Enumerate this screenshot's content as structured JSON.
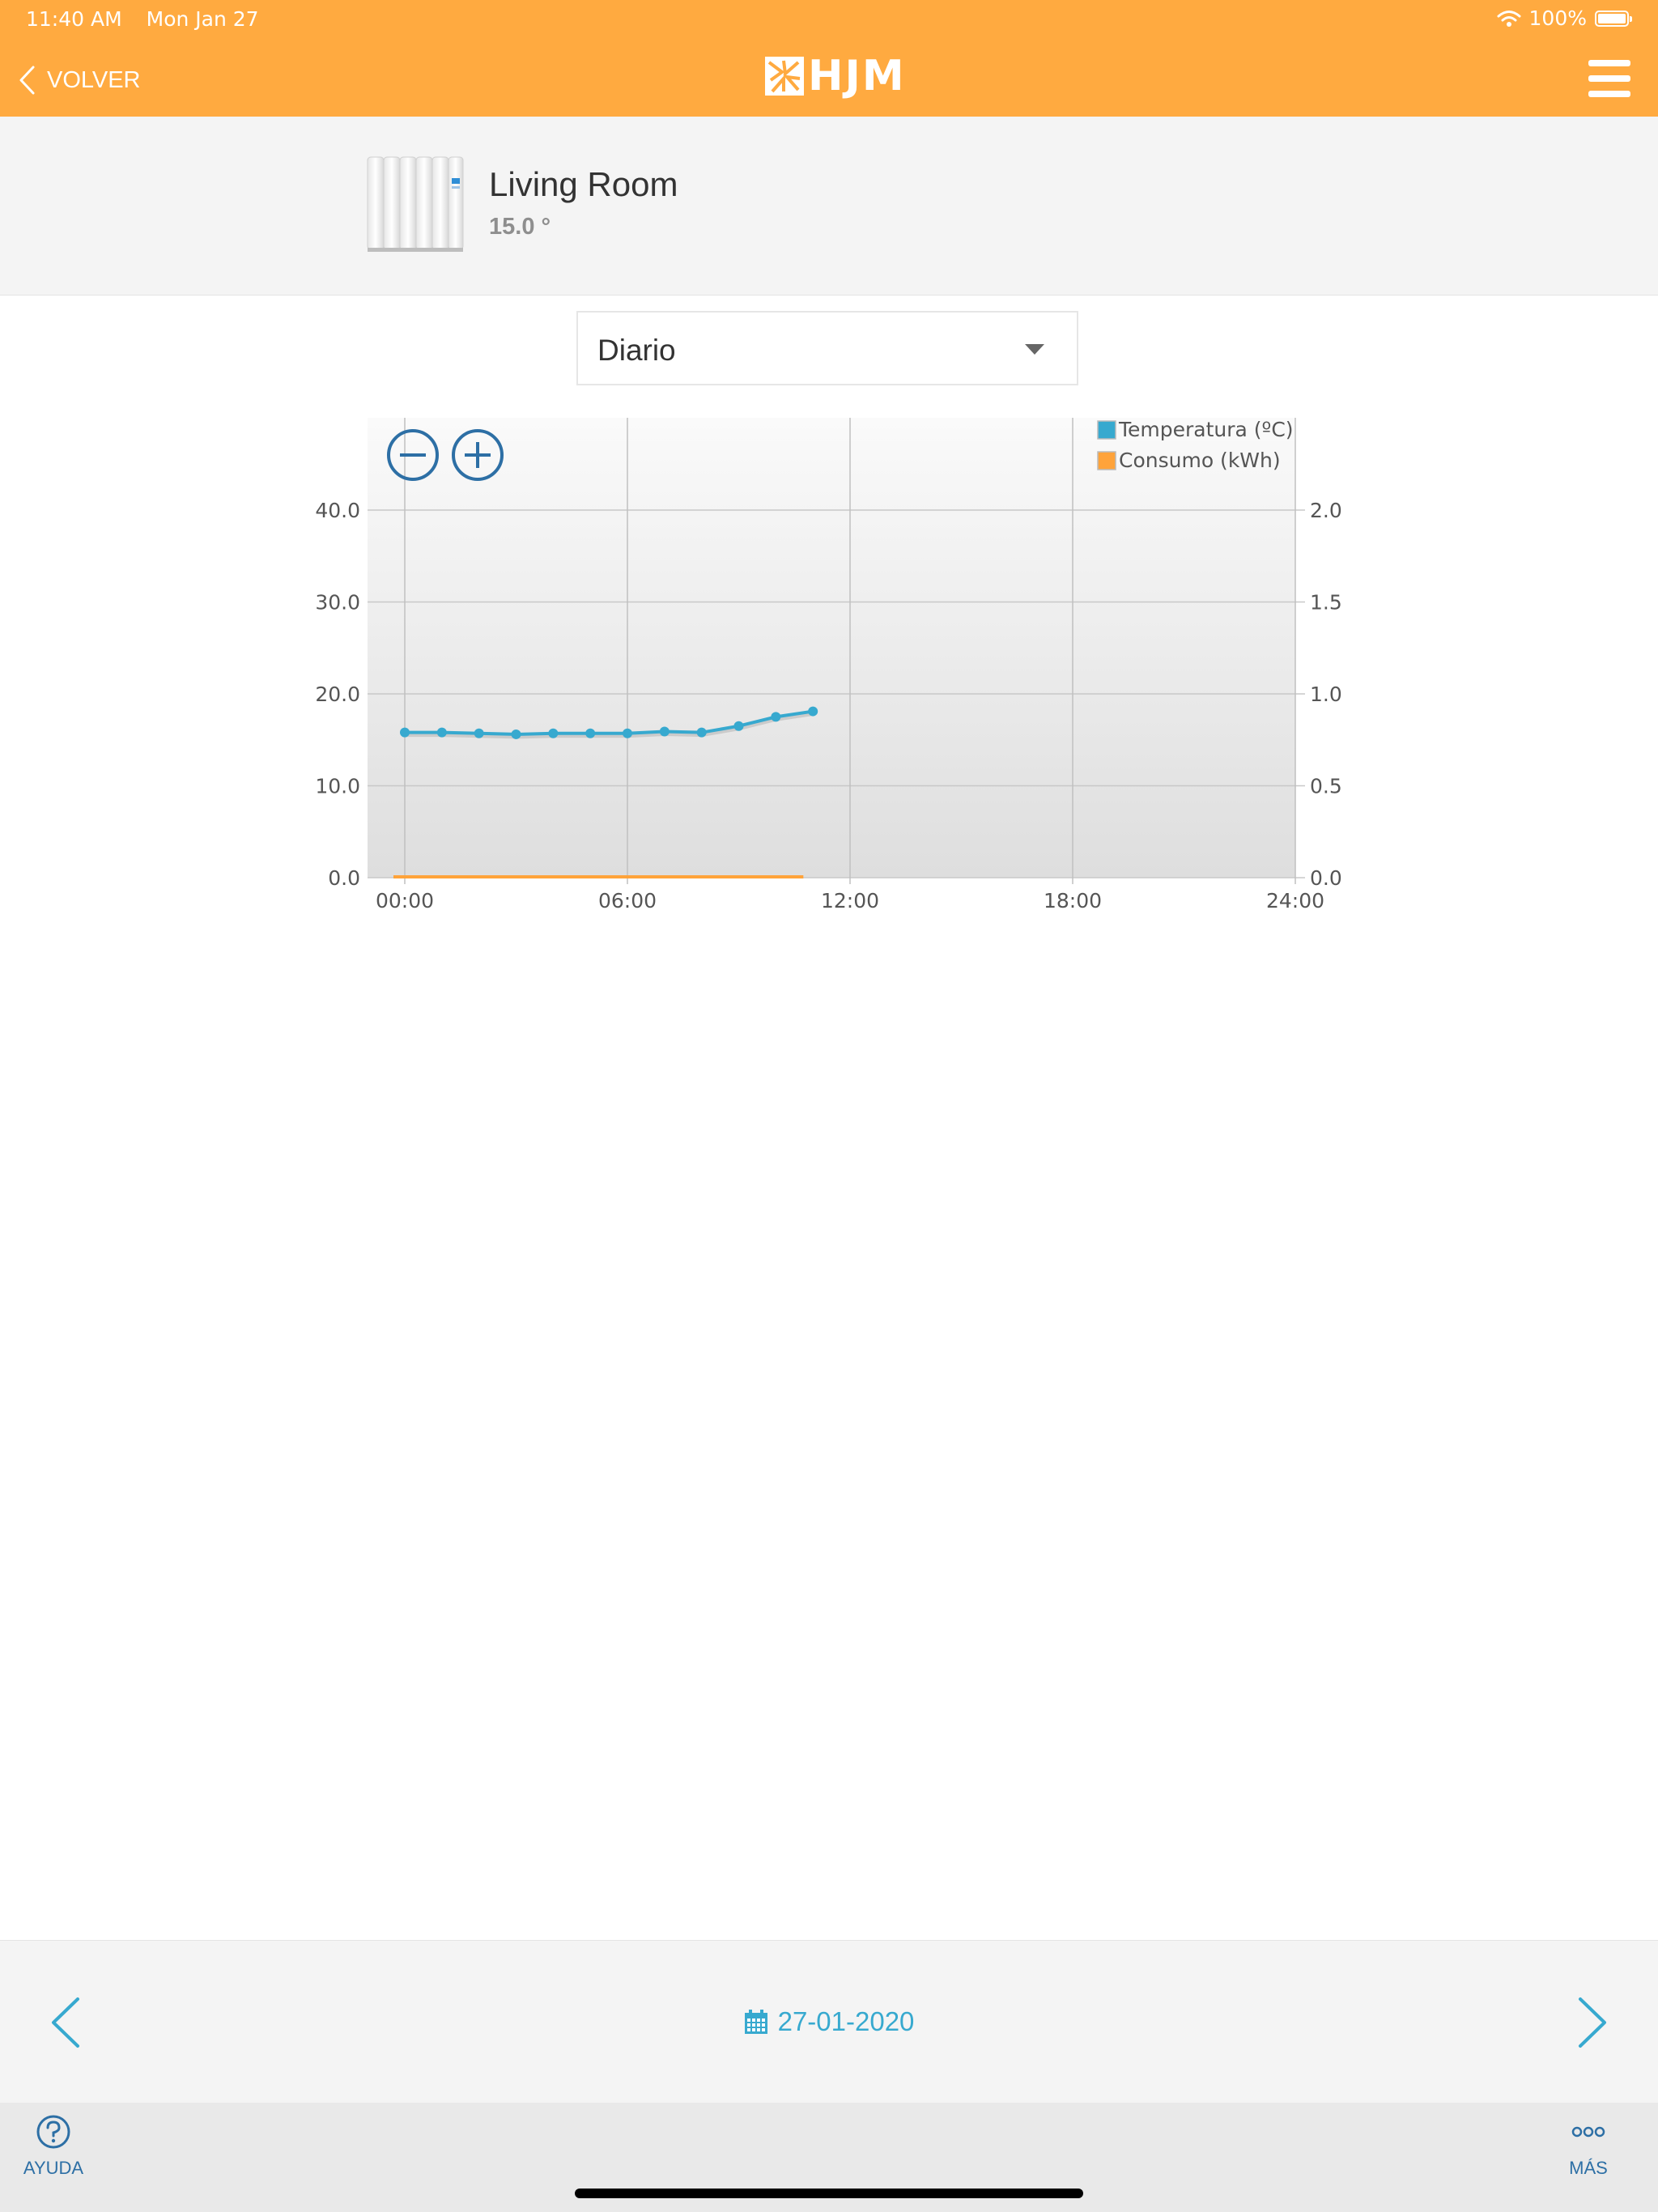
{
  "status_bar": {
    "time": "11:40 AM",
    "date": "Mon Jan 27",
    "battery": "100%",
    "wifi_icon": "wifi-icon",
    "battery_icon": "battery-icon"
  },
  "header": {
    "back_label": "VOLVER",
    "brand": "HJM",
    "menu_icon": "hamburger-menu-icon",
    "background": "#ffaa40"
  },
  "device": {
    "name": "Living Room",
    "temperature": "15.0 °",
    "icon": "radiator-icon"
  },
  "period_select": {
    "selected": "Diario"
  },
  "chart_data": {
    "type": "line",
    "x": [
      "00:00",
      "01:00",
      "02:00",
      "03:00",
      "04:00",
      "05:00",
      "06:00",
      "07:00",
      "08:00",
      "09:00",
      "10:00",
      "11:00"
    ],
    "x_range_hours": [
      0,
      24
    ],
    "x_ticks": [
      "00:00",
      "06:00",
      "12:00",
      "18:00",
      "24:00"
    ],
    "y_left_ticks": [
      "0.0",
      "10.0",
      "20.0",
      "30.0",
      "40.0"
    ],
    "y_right_ticks": [
      "0.0",
      "0.5",
      "1.0",
      "1.5",
      "2.0"
    ],
    "ylim_left": [
      0,
      40
    ],
    "ylim_right": [
      0,
      2
    ],
    "grid": true,
    "legend_position": "top-right",
    "series": [
      {
        "name": "Temperatura (ºC)",
        "axis": "left",
        "color": "#37a9cf",
        "hours": [
          0,
          1,
          2,
          3,
          4,
          5,
          6,
          7,
          8,
          9,
          10,
          11
        ],
        "values": [
          15.8,
          15.8,
          15.7,
          15.6,
          15.7,
          15.7,
          15.7,
          15.9,
          15.8,
          16.5,
          17.5,
          18.1
        ]
      },
      {
        "name": "Consumo (kWh)",
        "axis": "right",
        "color": "#ffa33a",
        "hours": [
          0,
          1,
          2,
          3,
          4,
          5,
          6,
          7,
          8,
          9,
          10
        ],
        "values": [
          0,
          0,
          0,
          0,
          0,
          0,
          0,
          0,
          0,
          0,
          0
        ]
      }
    ]
  },
  "date_nav": {
    "date": "27-01-2020",
    "prev_icon": "chevron-left-icon",
    "next_icon": "chevron-right-icon",
    "calendar_icon": "calendar-icon"
  },
  "tab_bar": {
    "help_label": "AYUDA",
    "more_label": "MÁS"
  }
}
